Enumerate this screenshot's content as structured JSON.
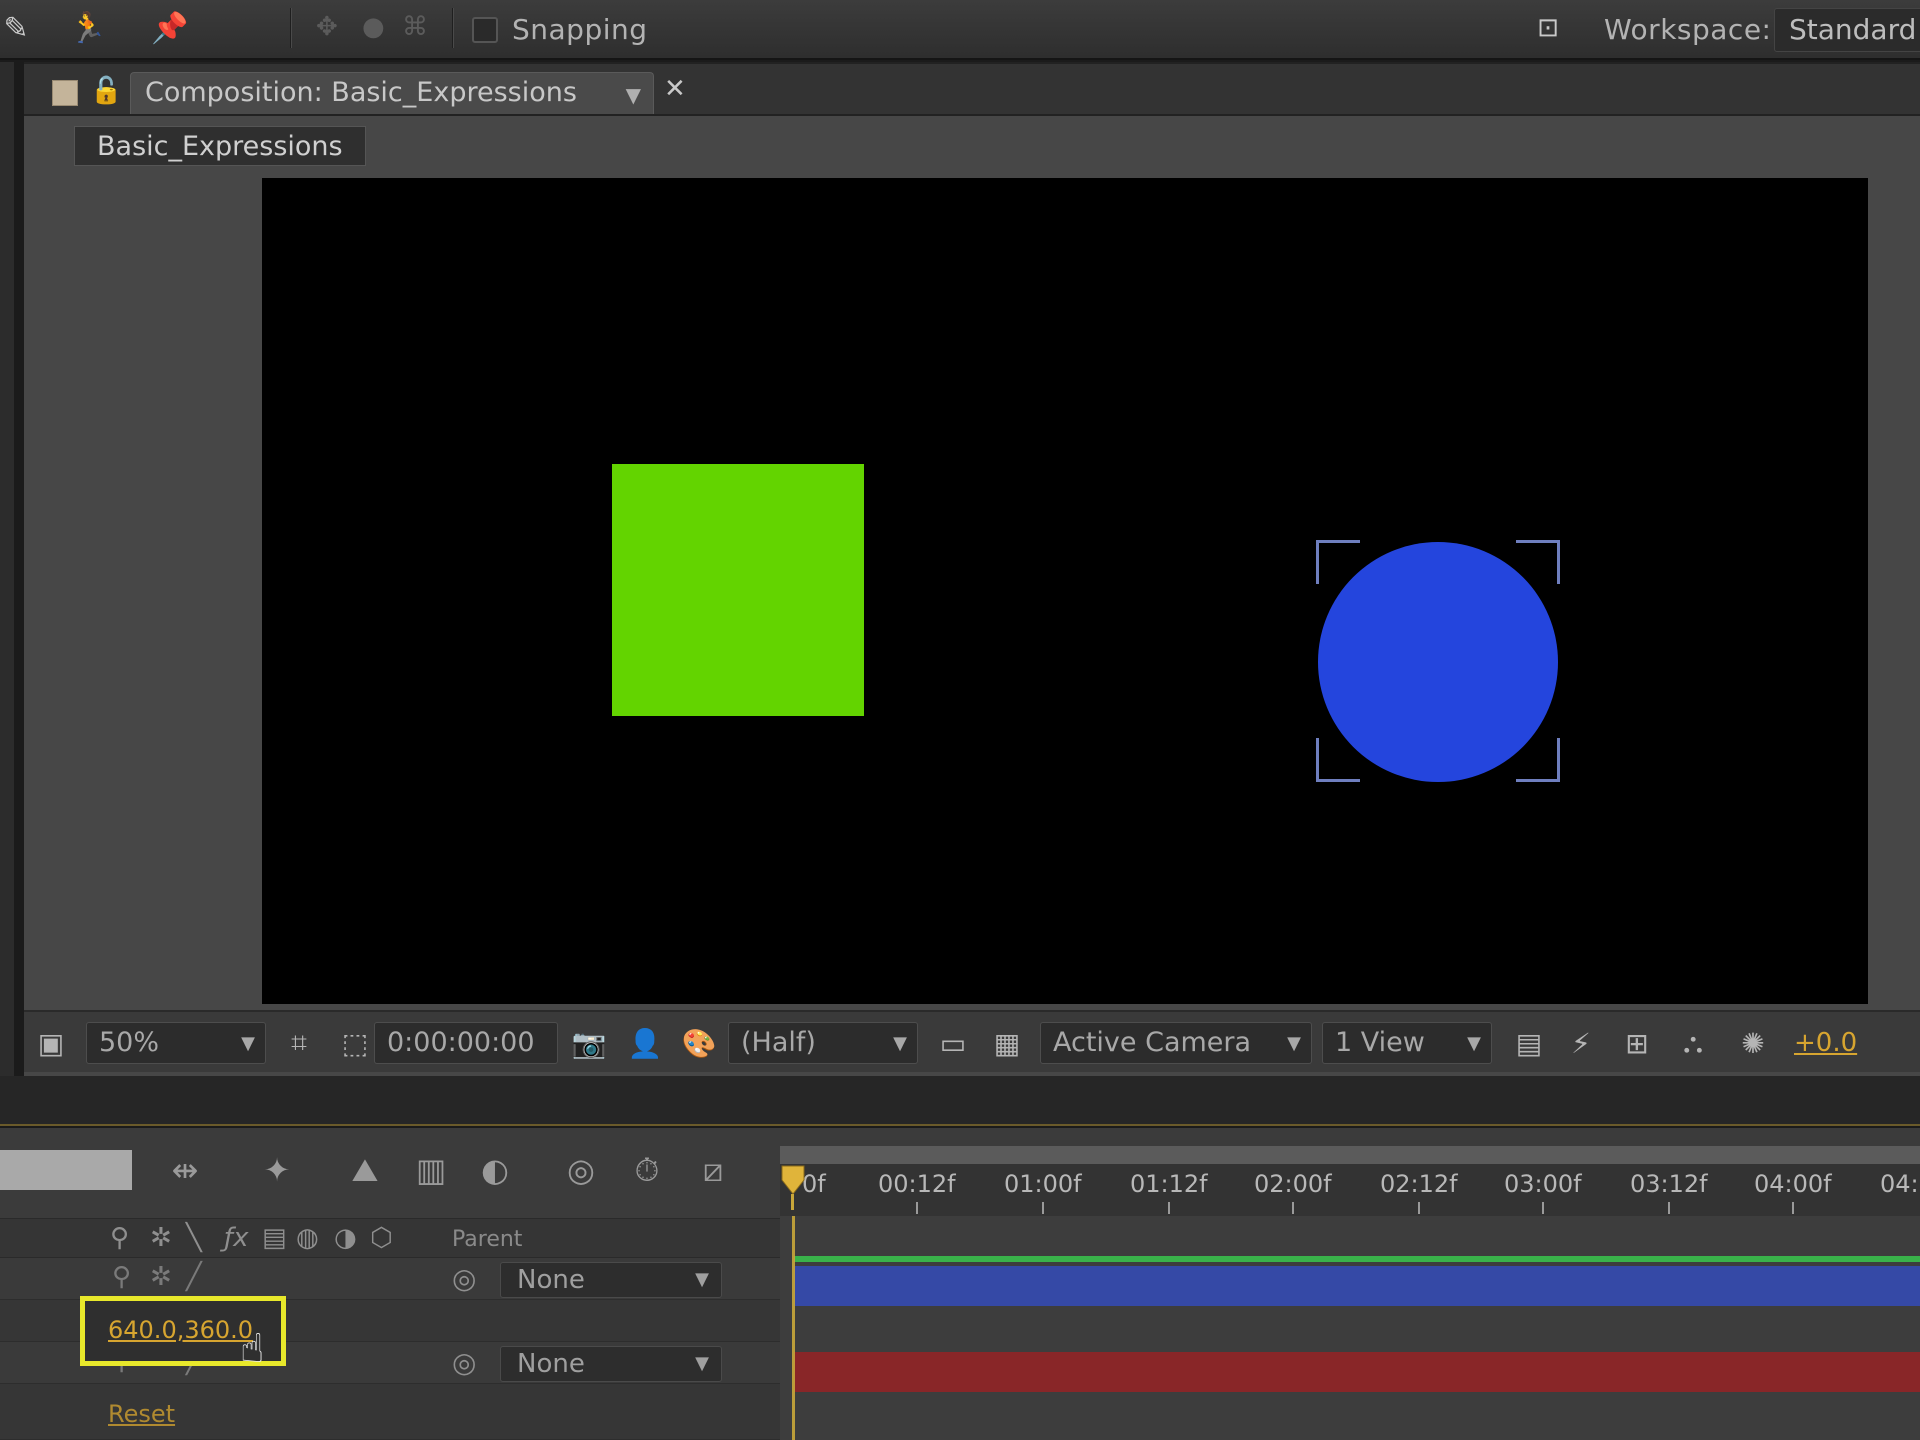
{
  "toolbar": {
    "snapping_label": "Snapping",
    "workspace_label": "Workspace:",
    "workspace_value": "Standard",
    "icons": [
      "brush-icon",
      "puppet-icon",
      "pin-icon",
      "axis-icon",
      "world-icon",
      "view-axis-icon",
      "workspace-icon"
    ]
  },
  "composition": {
    "tab_label": "Composition: Basic_Expressions",
    "breadcrumb": "Basic_Expressions",
    "shapes": {
      "square_color": "#63d400",
      "circle_color": "#2445dd"
    }
  },
  "viewer_bar": {
    "zoom": "50%",
    "timecode": "0:00:00:00",
    "resolution": "(Half)",
    "camera": "Active Camera",
    "views": "1 View",
    "exposure": "+0.0"
  },
  "timeline": {
    "parent_header": "Parent",
    "ruler_ticks": [
      "0f",
      "00:12f",
      "01:00f",
      "01:12f",
      "02:00f",
      "02:12f",
      "03:00f",
      "03:12f",
      "04:00f",
      "04:"
    ],
    "layers": [
      {
        "parent": "None",
        "bar_color": "#3549a6"
      },
      {
        "parent": "None",
        "bar_color": "#892628"
      }
    ],
    "position_value": "640.0,360.0",
    "reset_label": "Reset"
  }
}
